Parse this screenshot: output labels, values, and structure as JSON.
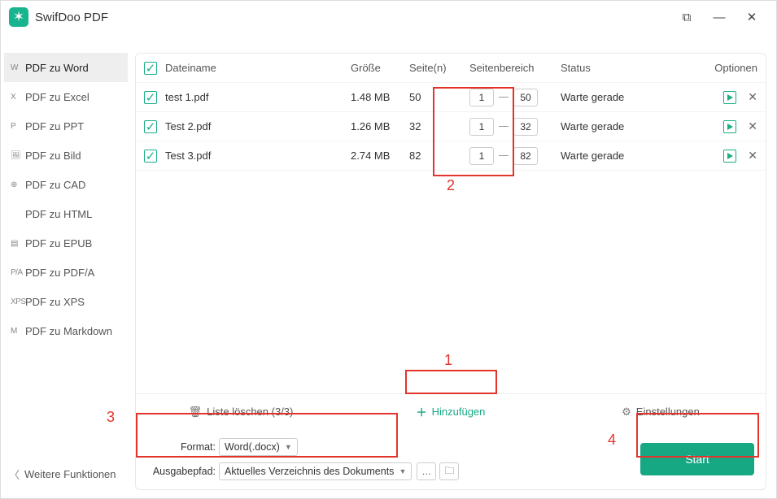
{
  "app": {
    "title": "SwifDoo PDF"
  },
  "sidebar": {
    "items": [
      {
        "badge": "W",
        "label": "PDF zu Word",
        "active": true
      },
      {
        "badge": "X",
        "label": "PDF zu Excel"
      },
      {
        "badge": "P",
        "label": "PDF zu PPT"
      },
      {
        "badge": "🖼",
        "label": "PDF zu Bild"
      },
      {
        "badge": "⊕",
        "label": "PDF zu CAD"
      },
      {
        "badge": "</>",
        "label": "PDF zu HTML"
      },
      {
        "badge": "▤",
        "label": "PDF zu EPUB"
      },
      {
        "badge": "P/A",
        "label": "PDF zu PDF/A"
      },
      {
        "badge": "XPS",
        "label": "PDF zu XPS"
      },
      {
        "badge": "M",
        "label": "PDF zu Markdown"
      }
    ],
    "more": "Weitere Funktionen"
  },
  "table": {
    "headers": {
      "name": "Dateiname",
      "size": "Größe",
      "pages": "Seite(n)",
      "range": "Seitenbereich",
      "status": "Status",
      "options": "Optionen"
    },
    "rows": [
      {
        "name": "test 1.pdf",
        "size": "1.48 MB",
        "pages": "50",
        "from": "1",
        "to": "50",
        "status": "Warte gerade"
      },
      {
        "name": "Test 2.pdf",
        "size": "1.26 MB",
        "pages": "32",
        "from": "1",
        "to": "32",
        "status": "Warte gerade"
      },
      {
        "name": "Test 3.pdf",
        "size": "2.74 MB",
        "pages": "82",
        "from": "1",
        "to": "82",
        "status": "Warte gerade"
      }
    ]
  },
  "toolbar": {
    "clear": "Liste löschen (3/3)",
    "add": "Hinzufügen",
    "settings": "Einstellungen"
  },
  "bottom": {
    "format_label": "Format:",
    "format_value": "Word(.docx)",
    "output_label": "Ausgabepfad:",
    "output_value": "Aktuelles Verzeichnis des Dokuments",
    "start": "Start"
  },
  "annotations": {
    "a1": "1",
    "a2": "2",
    "a3": "3",
    "a4": "4"
  }
}
